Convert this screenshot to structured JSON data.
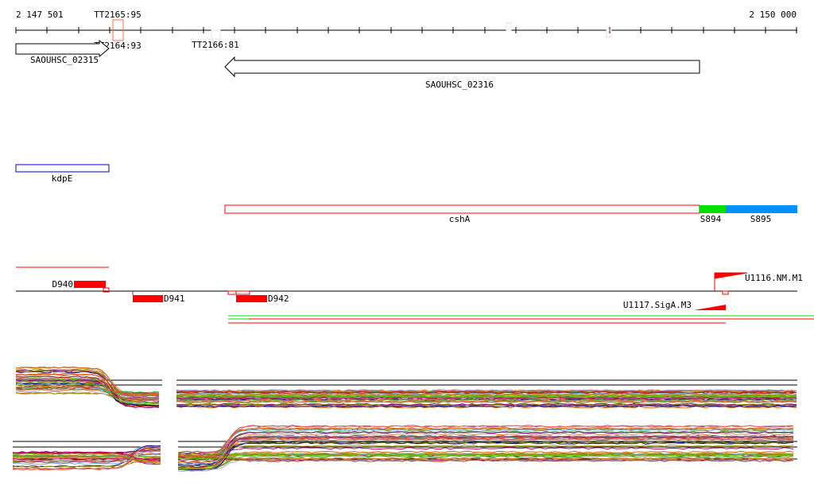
{
  "ruler": {
    "start_label": "2 147 501",
    "end_label": "2 150 000"
  },
  "terminators": [
    {
      "label": "TT2165:95"
    },
    {
      "label": "TT2164:93"
    },
    {
      "label": "TT2166:81"
    }
  ],
  "genes": [
    {
      "label": "SAOUHSC_02315",
      "strand": "+"
    },
    {
      "label": "SAOUHSC_02316",
      "strand": "-"
    }
  ],
  "operons": {
    "kdpE": "kdpE",
    "cshA": "cshA",
    "s894": "S894",
    "s895": "S895"
  },
  "segments": {
    "d940": "D940",
    "d941": "D941",
    "d942": "D942"
  },
  "upshifts": {
    "u1116": "U1116.NM.M1",
    "u1117": "U1117.SigA.M3"
  },
  "colors": {
    "red": "#ff0000",
    "green": "#00e000",
    "blue": "#0090ff",
    "kdpE": "#0000cc"
  }
}
